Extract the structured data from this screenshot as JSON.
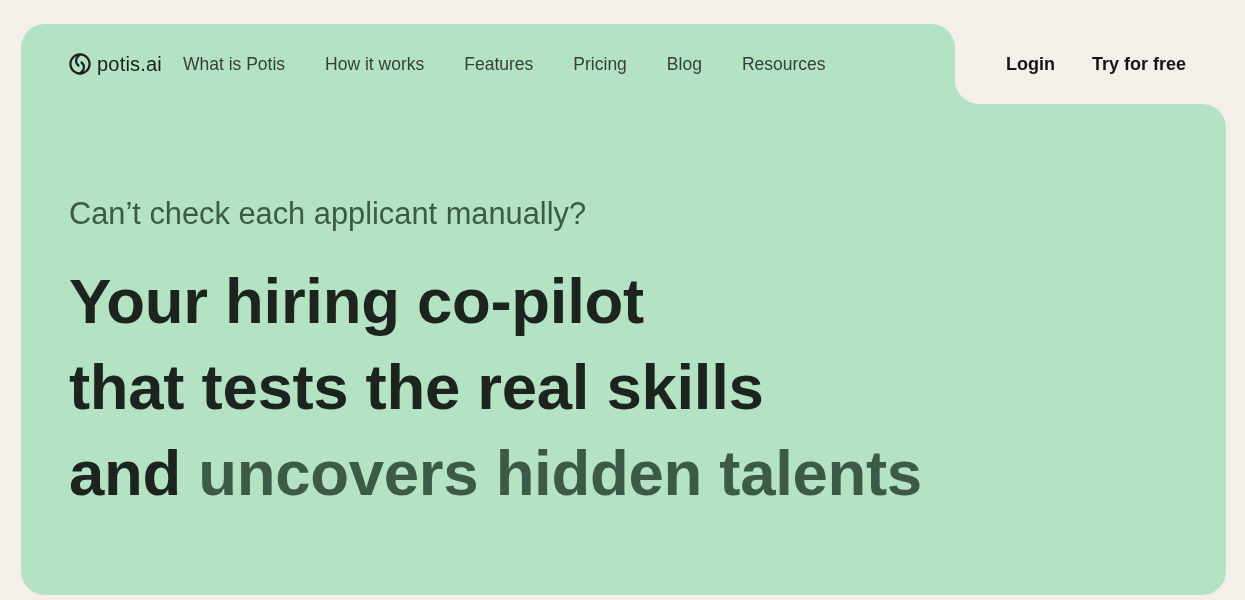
{
  "brand": {
    "name": "potis.ai"
  },
  "nav": {
    "links": [
      {
        "label": "What is Potis"
      },
      {
        "label": "How it works"
      },
      {
        "label": "Features"
      },
      {
        "label": "Pricing"
      },
      {
        "label": "Blog"
      },
      {
        "label": "Resources"
      }
    ]
  },
  "account": {
    "login": "Login",
    "signup": "Try for free"
  },
  "hero": {
    "subtitle": "Can’t check each applicant manually?",
    "heading": [
      {
        "parts": [
          {
            "text": "Your hiring co-pilot",
            "accent": false
          }
        ]
      },
      {
        "parts": [
          {
            "text": "that tests the real skills",
            "accent": false
          }
        ]
      },
      {
        "parts": [
          {
            "text": "and",
            "accent": false
          },
          {
            "text": "uncovers hidden talents",
            "accent": true
          }
        ]
      }
    ]
  }
}
